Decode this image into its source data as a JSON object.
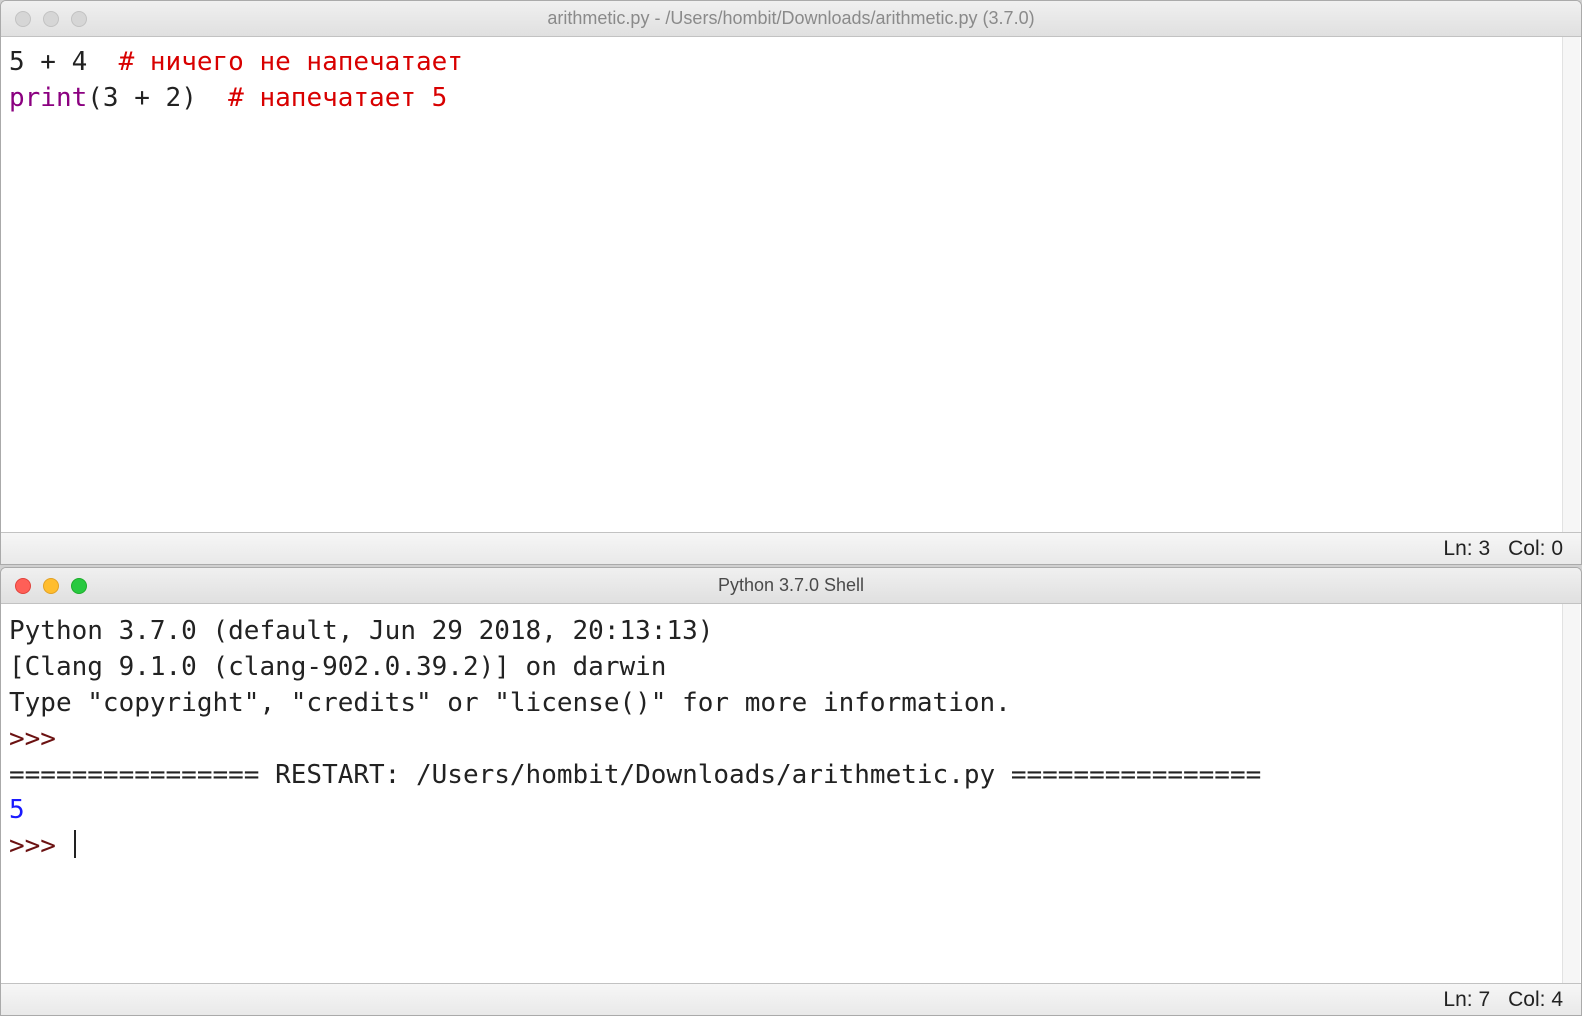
{
  "editor": {
    "title": "arithmetic.py - /Users/hombit/Downloads/arithmetic.py (3.7.0)",
    "line1_code": "5 + 4  ",
    "line1_comment": "# ничего не напечатает",
    "line2_builtin": "print",
    "line2_rest": "(3 + 2)  ",
    "line2_comment": "# напечатает 5",
    "status_ln_label": "Ln: ",
    "status_ln_value": "3",
    "status_col_label": "Col: ",
    "status_col_value": "0"
  },
  "shell": {
    "title": "Python 3.7.0 Shell",
    "banner_line1": "Python 3.7.0 (default, Jun 29 2018, 20:13:13) ",
    "banner_line2": "[Clang 9.1.0 (clang-902.0.39.2)] on darwin",
    "banner_line3": "Type \"copyright\", \"credits\" or \"license()\" for more information.",
    "prompt": ">>> ",
    "restart_line": "================ RESTART: /Users/hombit/Downloads/arithmetic.py ================",
    "output_value": "5",
    "status_ln_label": "Ln: ",
    "status_ln_value": "7",
    "status_col_label": "Col: ",
    "status_col_value": "4"
  }
}
